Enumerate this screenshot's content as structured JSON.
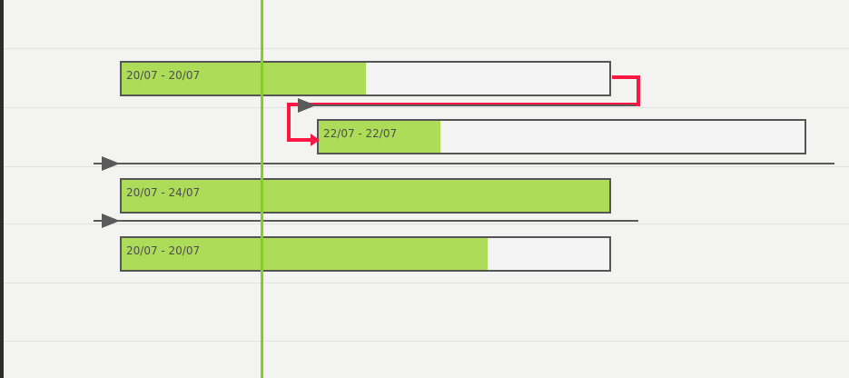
{
  "colors": {
    "background": "#f3f3f2",
    "progress": "#addd58",
    "task_border": "#555555",
    "today_marker": "#7ed321",
    "critical_link": "#ff1744",
    "link": "#5a5a5a"
  },
  "tasks": [
    {
      "label": "20/07 - 20/07",
      "progress": 0.5
    },
    {
      "label": "22/07 - 22/07",
      "progress": 0.25
    },
    {
      "label": "20/07 - 24/07",
      "progress": 1.0
    },
    {
      "label": "20/07 - 20/07",
      "progress": 0.75
    }
  ],
  "links": [
    {
      "from": 0,
      "to": 1,
      "type": "critical"
    }
  ]
}
